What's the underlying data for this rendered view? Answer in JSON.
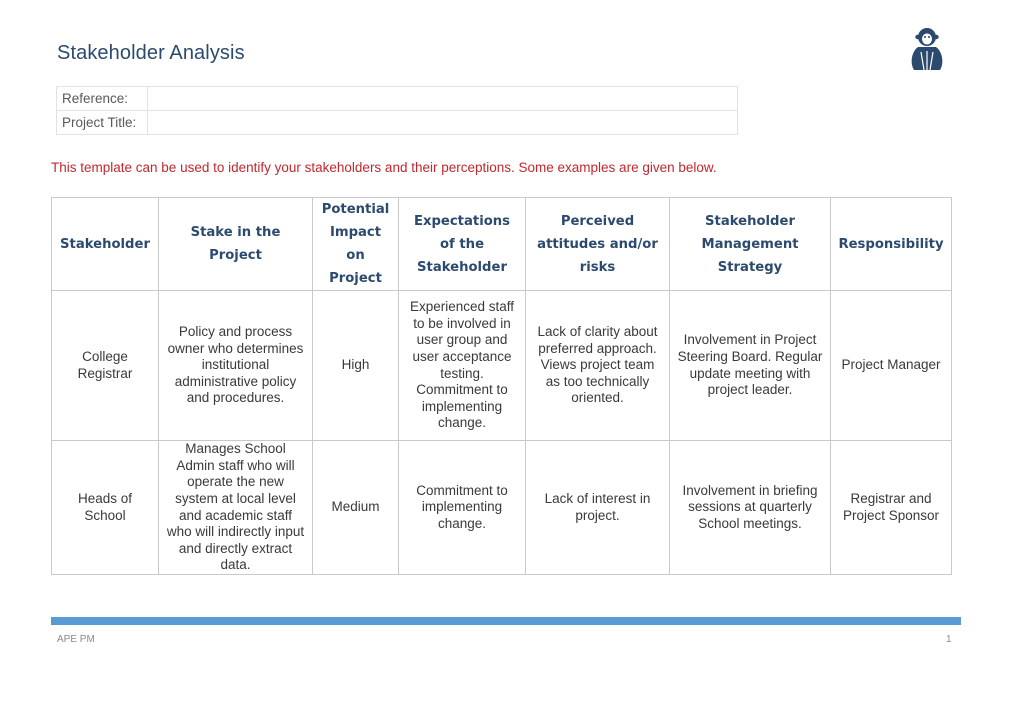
{
  "document": {
    "title": "Stakeholder Analysis",
    "logo": "monkey-logo-icon",
    "brand_color": "#2c4a6e",
    "accent_color": "#5b9bd5",
    "intro_color": "#c0282d"
  },
  "reference_table": [
    {
      "label": "Reference:",
      "value": ""
    },
    {
      "label": "Project Title:",
      "value": ""
    }
  ],
  "intro_text": "This template can be used to identify your stakeholders and their perceptions.  Some examples are given below.",
  "stakeholder_table": {
    "headers": [
      "Stakeholder",
      "Stake in the Project",
      "Potential Impact on Project",
      "Expectations of the Stakeholder",
      "Perceived attitudes and/or risks",
      "Stakeholder Management Strategy",
      "Responsibility"
    ],
    "rows": [
      [
        "College Registrar",
        "Policy and process owner who determines institutional administrative policy and procedures.",
        "High",
        "Experienced staff to be involved in user group and user acceptance testing. Commitment to implementing change.",
        "Lack of clarity about preferred approach. Views project team as too technically oriented.",
        "Involvement in Project Steering Board. Regular update meeting with project leader.",
        "Project Manager"
      ],
      [
        "Heads of School",
        "Manages School Admin staff who will operate the new system at local level and academic staff who will indirectly input and directly extract data.",
        "Medium",
        "Commitment to implementing change.",
        "Lack of interest in project.",
        "Involvement in briefing sessions at quarterly School meetings.",
        "Registrar and Project Sponsor"
      ]
    ]
  },
  "footer": {
    "left": "APE PM",
    "page_number": "1"
  }
}
